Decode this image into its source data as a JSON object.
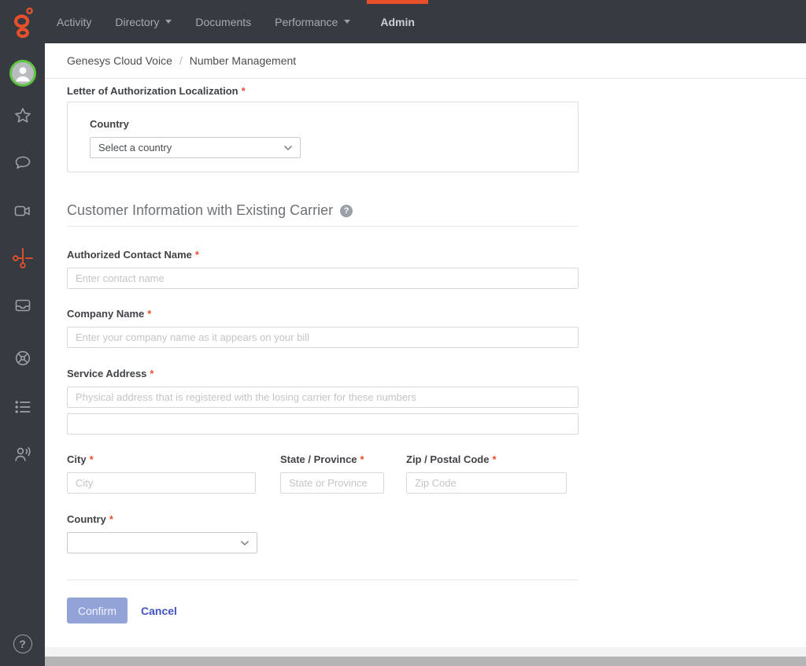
{
  "nav": {
    "items": [
      {
        "label": "Activity",
        "caret": false,
        "active": false
      },
      {
        "label": "Directory",
        "caret": true,
        "active": false
      },
      {
        "label": "Documents",
        "caret": false,
        "active": false
      },
      {
        "label": "Performance",
        "caret": true,
        "active": false
      },
      {
        "label": "Admin",
        "caret": false,
        "active": true
      }
    ]
  },
  "sidebar": {
    "icons": [
      "profile-avatar",
      "star",
      "chat-bubble",
      "video-camera",
      "scissors",
      "inbox-tray",
      "helm-wheel",
      "bulleted-list",
      "person-speaking",
      "help"
    ],
    "active_icon": "scissors"
  },
  "breadcrumb": {
    "parent": "Genesys Cloud Voice",
    "separator": "/",
    "current": "Number Management"
  },
  "ui": {
    "required_marker": "*",
    "help_glyph": "?"
  },
  "loa_box": {
    "label": "Letter of Authorization Localization",
    "country_label": "Country",
    "country_select_placeholder": "Select a country"
  },
  "carrier_section": {
    "title": "Customer Information with Existing Carrier"
  },
  "fields": {
    "contact_name": {
      "label": "Authorized Contact Name",
      "placeholder": "Enter contact name",
      "value": ""
    },
    "company_name": {
      "label": "Company Name",
      "placeholder": "Enter your company name as it appears on your bill",
      "value": ""
    },
    "service_address": {
      "label": "Service Address",
      "placeholder": "Physical address that is registered with the losing carrier for these numbers",
      "placeholder_line2": "",
      "value": ""
    },
    "city": {
      "label": "City",
      "placeholder": "City",
      "value": ""
    },
    "state": {
      "label": "State / Province",
      "placeholder": "State or Province",
      "value": ""
    },
    "zip": {
      "label": "Zip / Postal Code",
      "placeholder": "Zip Code",
      "value": ""
    },
    "country": {
      "label": "Country",
      "selected_value": ""
    }
  },
  "actions": {
    "confirm_label": "Confirm",
    "cancel_label": "Cancel"
  },
  "colors": {
    "accent_orange": "#E8502B",
    "nav_background": "#363B41",
    "avatar_ring_green": "#5FC540",
    "confirm_button_bg": "#93A3D8",
    "cancel_link": "#4254C5",
    "required_asterisk": "#E4502E",
    "scrollbar_gray": "#B5B5B5"
  }
}
